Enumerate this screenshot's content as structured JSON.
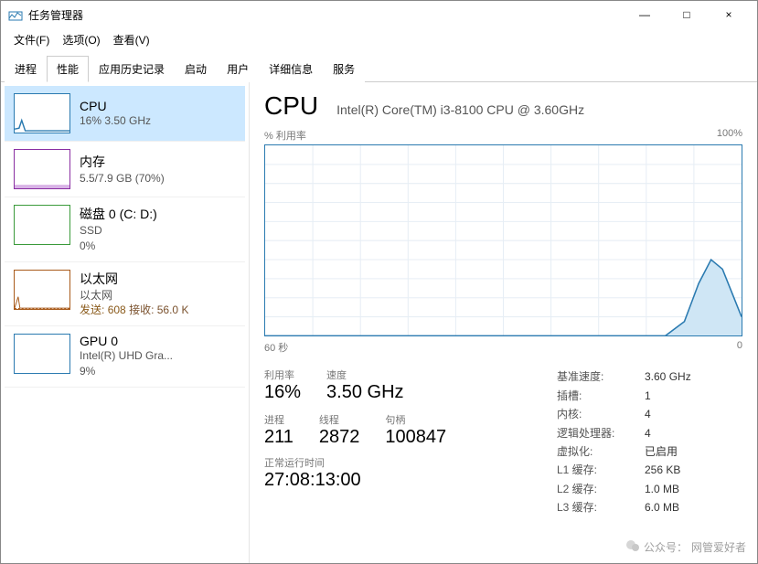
{
  "window": {
    "title": "任务管理器",
    "controls": {
      "min": "—",
      "max": "□",
      "close": "×"
    }
  },
  "menu": {
    "file": "文件(F)",
    "options": "选项(O)",
    "view": "查看(V)"
  },
  "tabs": [
    {
      "label": "进程"
    },
    {
      "label": "性能"
    },
    {
      "label": "应用历史记录"
    },
    {
      "label": "启动"
    },
    {
      "label": "用户"
    },
    {
      "label": "详细信息"
    },
    {
      "label": "服务"
    }
  ],
  "active_tab_index": 1,
  "sidebar": {
    "items": [
      {
        "title": "CPU",
        "sub1": "16% 3.50 GHz",
        "color": "#2a7ab0"
      },
      {
        "title": "内存",
        "sub1": "5.5/7.9 GB (70%)",
        "color": "#8a2ea2"
      },
      {
        "title": "磁盘 0 (C: D:)",
        "sub1": "SSD",
        "sub2": "0%",
        "color": "#3a9a3a"
      },
      {
        "title": "以太网",
        "sub1": "以太网",
        "sendrecv": {
          "send_label": "发送:",
          "send_value": "608",
          "recv_label": "接收:",
          "recv_value": "56.0 K"
        },
        "color": "#a95a1a"
      },
      {
        "title": "GPU 0",
        "sub1": "Intel(R) UHD Gra...",
        "sub2": "9%",
        "color": "#2a7ab0"
      }
    ],
    "selected_index": 0
  },
  "main": {
    "heading": "CPU",
    "subheading": "Intel(R) Core(TM) i3-8100 CPU @ 3.60GHz",
    "chart_header_left": "% 利用率",
    "chart_header_right": "100%",
    "xaxis_left": "60 秒",
    "xaxis_right": "0",
    "stats1": [
      {
        "label": "利用率",
        "value": "16%"
      },
      {
        "label": "速度",
        "value": "3.50 GHz"
      }
    ],
    "stats2": [
      {
        "label": "进程",
        "value": "211"
      },
      {
        "label": "线程",
        "value": "2872"
      },
      {
        "label": "句柄",
        "value": "100847"
      }
    ],
    "uptime_label": "正常运行时间",
    "uptime_value": "27:08:13:00",
    "kv": [
      {
        "k": "基准速度:",
        "v": "3.60 GHz"
      },
      {
        "k": "插槽:",
        "v": "1"
      },
      {
        "k": "内核:",
        "v": "4"
      },
      {
        "k": "逻辑处理器:",
        "v": "4"
      },
      {
        "k": "虚拟化:",
        "v": "已启用"
      },
      {
        "k": "L1 缓存:",
        "v": "256 KB"
      },
      {
        "k": "L2 缓存:",
        "v": "1.0 MB"
      },
      {
        "k": "L3 缓存:",
        "v": "6.0 MB"
      }
    ]
  },
  "watermark": {
    "prefix": "公众号：",
    "name": "网管爱好者"
  },
  "chart_data": {
    "type": "area",
    "title": "% 利用率",
    "xlabel": "60 秒 → 0",
    "ylabel": "% 利用率",
    "ylim": [
      0,
      100
    ],
    "xlim_seconds": [
      60,
      0
    ],
    "x_seconds_ago": [
      60,
      58,
      56,
      54,
      52,
      50,
      48,
      46,
      44,
      42,
      40,
      38,
      36,
      34,
      32,
      30,
      28,
      26,
      24,
      22,
      20,
      18,
      16,
      14,
      12,
      10,
      8,
      6,
      4,
      2,
      0
    ],
    "values_percent": [
      0,
      0,
      0,
      0,
      0,
      0,
      0,
      0,
      0,
      0,
      0,
      0,
      0,
      0,
      0,
      0,
      0,
      0,
      0,
      0,
      0,
      0,
      0,
      0,
      0,
      8,
      28,
      40,
      35,
      20,
      10
    ]
  }
}
